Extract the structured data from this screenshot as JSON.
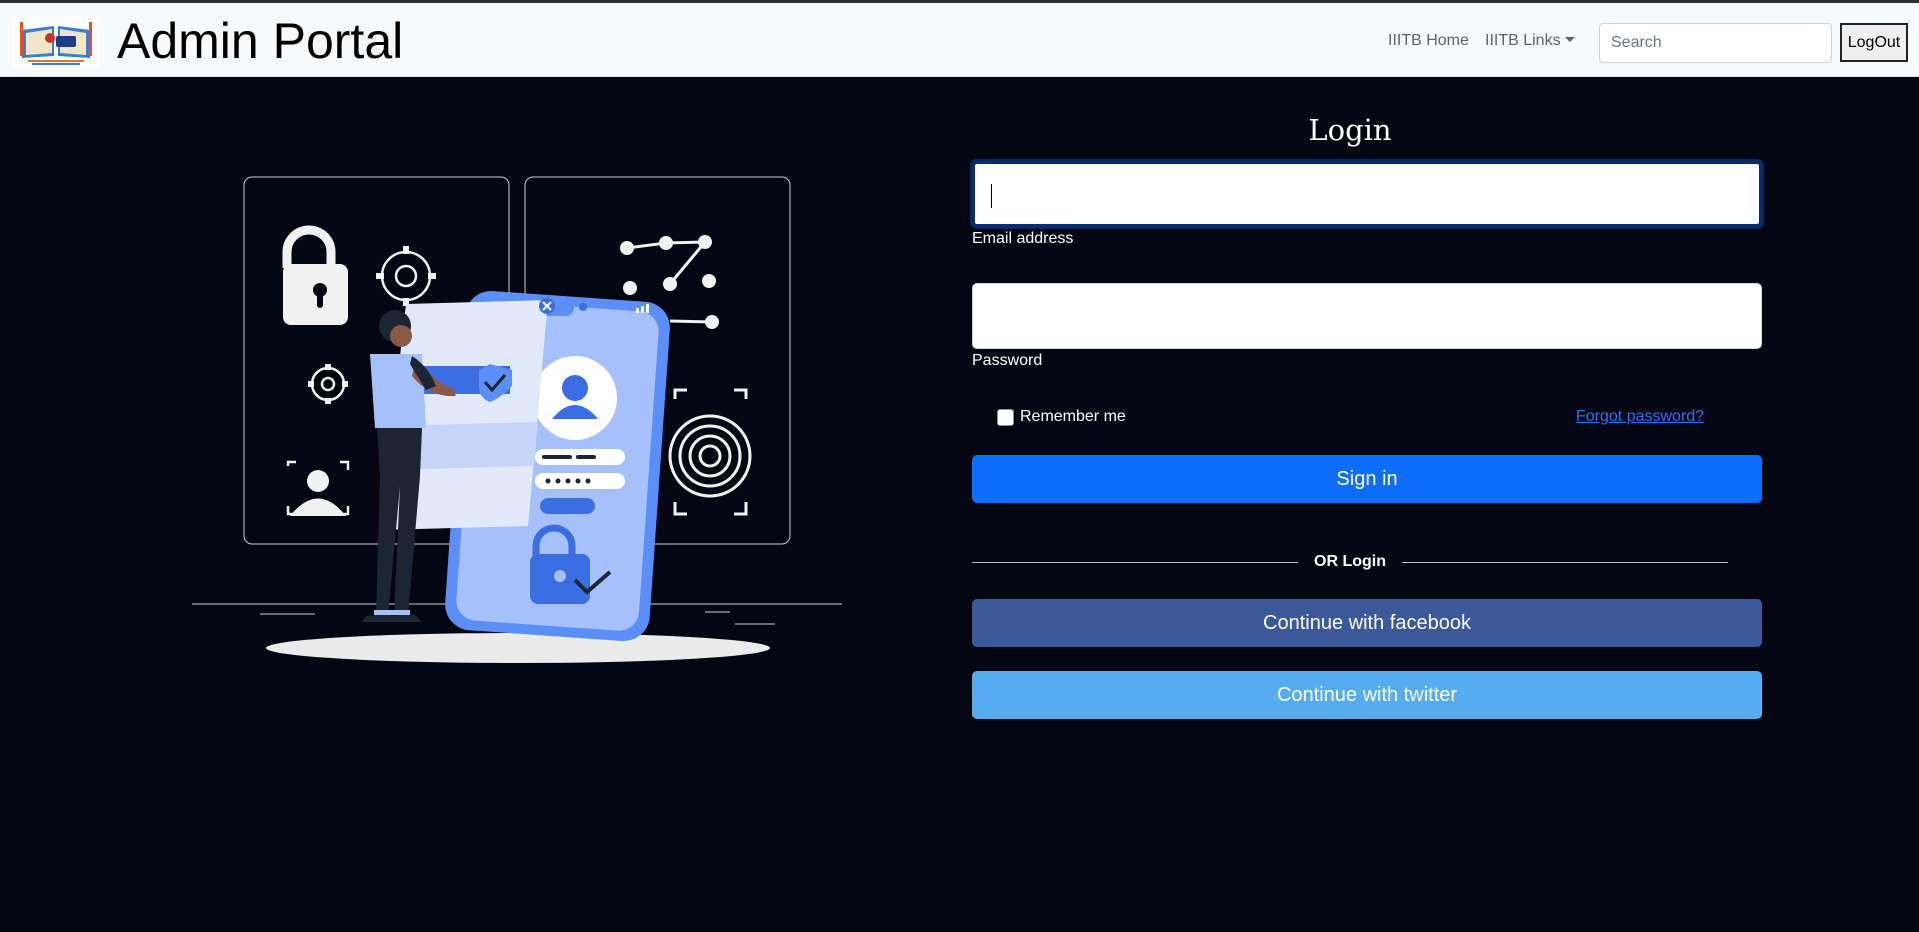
{
  "header": {
    "title": "Admin Portal",
    "logo_name": "iiitb-logo",
    "nav": {
      "home_label": "IIITB Home",
      "links_label": "IIITB Links"
    },
    "search": {
      "placeholder": "Search",
      "value": ""
    },
    "logout_label": "LogOut"
  },
  "login": {
    "title": "Login",
    "email": {
      "label": "Email address",
      "value": ""
    },
    "password": {
      "label": "Password",
      "value": ""
    },
    "remember_label": "Remember me",
    "remember_checked": false,
    "forgot_label": "Forgot password?",
    "signin_label": "Sign in",
    "divider_label": "OR Login",
    "facebook_label": "Continue with facebook",
    "twitter_label": "Continue with twitter"
  },
  "colors": {
    "background": "#040711",
    "primary": "#0d6efd",
    "facebook": "#3b5998",
    "twitter": "#55acee",
    "link": "#2f6ef6"
  }
}
